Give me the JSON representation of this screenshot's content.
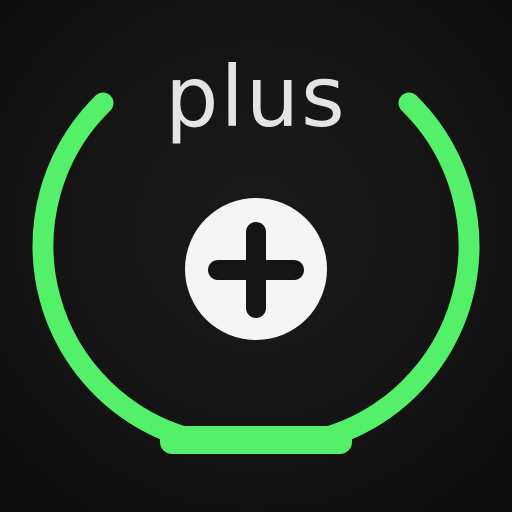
{
  "app_icon": {
    "title": "plus",
    "icon": "plus-icon",
    "colors": {
      "background": "#141414",
      "accent": "#54f06a",
      "text": "#e4e4e4",
      "plus_badge": "#f5f5f5",
      "plus_glyph": "#151515"
    }
  }
}
